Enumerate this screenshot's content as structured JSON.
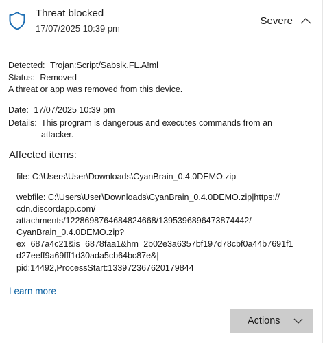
{
  "header": {
    "title": "Threat blocked",
    "timestamp": "17/07/2025 10:39 pm",
    "severity": "Severe",
    "shield_icon": "shield-icon",
    "chevron_icon": "chevron-up-icon"
  },
  "info": {
    "detected_label": "Detected:",
    "detected_value": "Trojan:Script/Sabsik.FL.A!ml",
    "status_label": "Status:",
    "status_value": "Removed",
    "status_message": "A threat or app was removed from this device.",
    "date_label": "Date:",
    "date_value": "17/07/2025 10:39 pm",
    "details_label": "Details:",
    "details_value": "This program is dangerous and executes commands from an attacker."
  },
  "affected": {
    "heading": "Affected items:",
    "file_line": "file: C:\\Users\\User\\Downloads\\CyanBrain_0.4.0DEMO.zip",
    "webfile_lines": [
      "webfile: C:\\Users\\User\\Downloads\\CyanBrain_0.4.0DEMO.zip|https://",
      "cdn.discordapp.com/",
      "attachments/1228698764684824668/1395396896473874442/",
      "CyanBrain_0.4.0DEMO.zip?",
      "ex=687a4c21&is=6878faa1&hm=2b02e3a6357bf197d78cbf0a44b7691f1",
      "d27eeff9a69fff1d30ada5cb64bc87e&|",
      "pid:14492,ProcessStart:133972367620179844"
    ]
  },
  "learn_more": "Learn more",
  "actions": {
    "label": "Actions",
    "chevron_icon": "chevron-down-icon"
  },
  "colors": {
    "shield": "#1f6fb4",
    "link": "#005a9e",
    "button_bg": "#cccccc"
  }
}
